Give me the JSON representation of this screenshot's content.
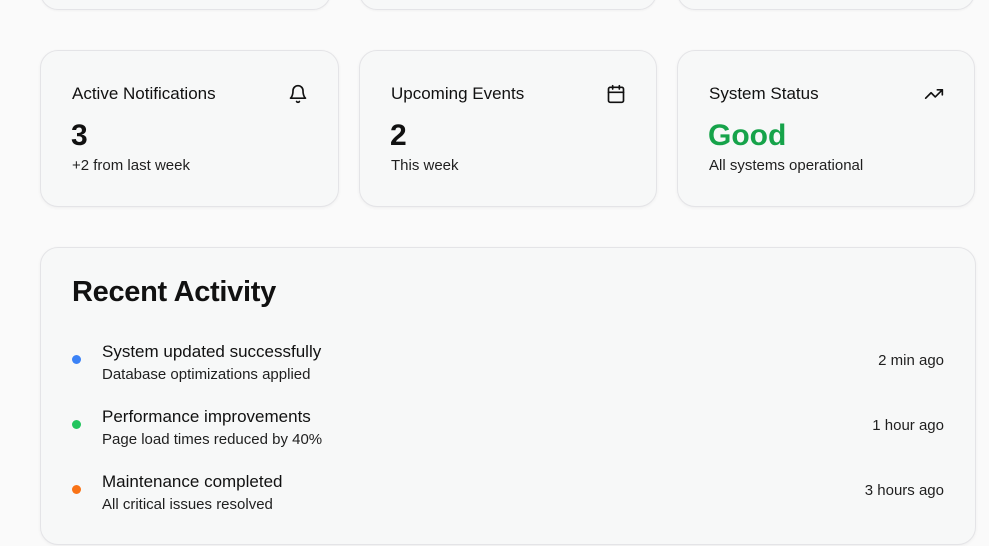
{
  "stats": {
    "notifications": {
      "title": "Active Notifications",
      "value": "3",
      "sub": "+2 from last week",
      "icon": "bell-icon"
    },
    "events": {
      "title": "Upcoming Events",
      "value": "2",
      "sub": "This week",
      "icon": "calendar-icon"
    },
    "status": {
      "title": "System Status",
      "value": "Good",
      "sub": "All systems operational",
      "icon": "trending-up-icon",
      "value_color": "#16a34a"
    }
  },
  "activity": {
    "title": "Recent Activity",
    "items": [
      {
        "title": "System updated successfully",
        "desc": "Database optimizations applied",
        "time": "2 min ago",
        "dot_color": "#3b82f6"
      },
      {
        "title": "Performance improvements",
        "desc": "Page load times reduced by 40%",
        "time": "1 hour ago",
        "dot_color": "#22c55e"
      },
      {
        "title": "Maintenance completed",
        "desc": "All critical issues resolved",
        "time": "3 hours ago",
        "dot_color": "#f97316"
      }
    ]
  }
}
